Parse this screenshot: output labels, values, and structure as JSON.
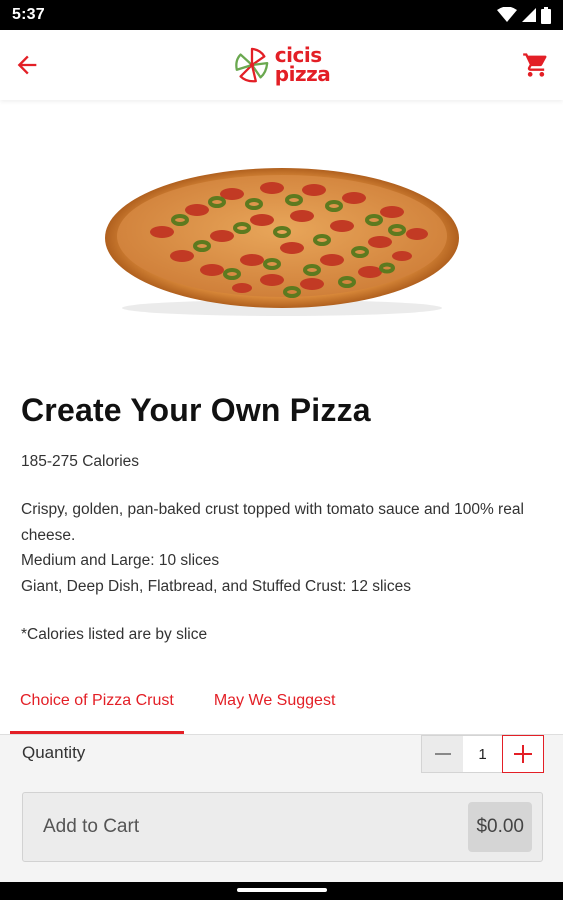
{
  "status_bar": {
    "time": "5:37"
  },
  "header": {
    "logo_line1": "cicis",
    "logo_line2": "pizza",
    "back_icon": "arrow-left-icon",
    "cart_icon": "shopping-cart-icon"
  },
  "product": {
    "title": "Create Your Own Pizza",
    "calories": "185-275 Calories",
    "description": [
      "Crispy, golden, pan-baked crust topped with tomato sauce and 100% real cheese.",
      "Medium and Large: 10 slices",
      "Giant, Deep Dish, Flatbread, and Stuffed Crust: 12 slices"
    ],
    "note": "*Calories listed are by slice"
  },
  "tabs": [
    {
      "label": "Choice of Pizza Crust",
      "active": true
    },
    {
      "label": "May We Suggest",
      "active": false
    }
  ],
  "order": {
    "quantity_label": "Quantity",
    "quantity": "1",
    "add_to_cart_label": "Add to Cart",
    "price": "$0.00"
  },
  "colors": {
    "accent": "#e31f26",
    "panel_bg": "#f4f4f4"
  }
}
